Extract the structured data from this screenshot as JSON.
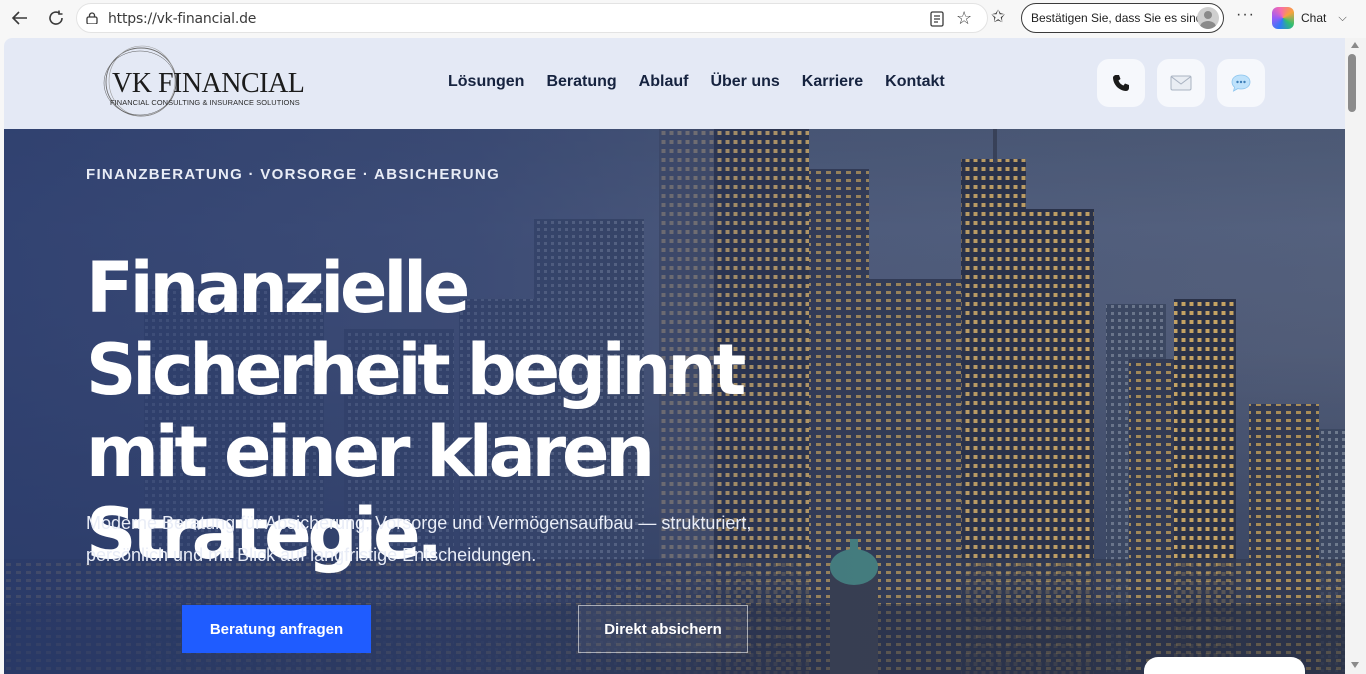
{
  "browser": {
    "url": "https://vk-financial.de",
    "verify_label": "Bestätigen Sie, dass Sie es sind",
    "more_label": "···",
    "copilot_label": "Chat"
  },
  "site": {
    "logo": {
      "name": "VK FINANCIAL",
      "tagline": "FINANCIAL CONSULTING & INSURANCE SOLUTIONS"
    },
    "nav": [
      "Lösungen",
      "Beratung",
      "Ablauf",
      "Über uns",
      "Karriere",
      "Kontakt"
    ],
    "contact_icons": [
      "phone-icon",
      "mail-icon",
      "chat-bubble-icon"
    ]
  },
  "hero": {
    "eyebrow": "FINANZBERATUNG · VORSORGE · ABSICHERUNG",
    "headline": "Finanzielle Sicherheit beginnt mit einer klaren Strategie.",
    "subline": "Moderne Beratung für Absicherung, Vorsorge und Vermögensaufbau — strukturiert, persönlich und mit Blick auf langfristige Entscheidungen.",
    "cta_primary": "Beratung anfragen",
    "cta_secondary": "Direkt absichern"
  },
  "colors": {
    "header_bg": "#e4e9f5",
    "nav_text": "#16233f",
    "primary_button": "#1f5cff",
    "hero_overlay": "#2d3e70"
  }
}
